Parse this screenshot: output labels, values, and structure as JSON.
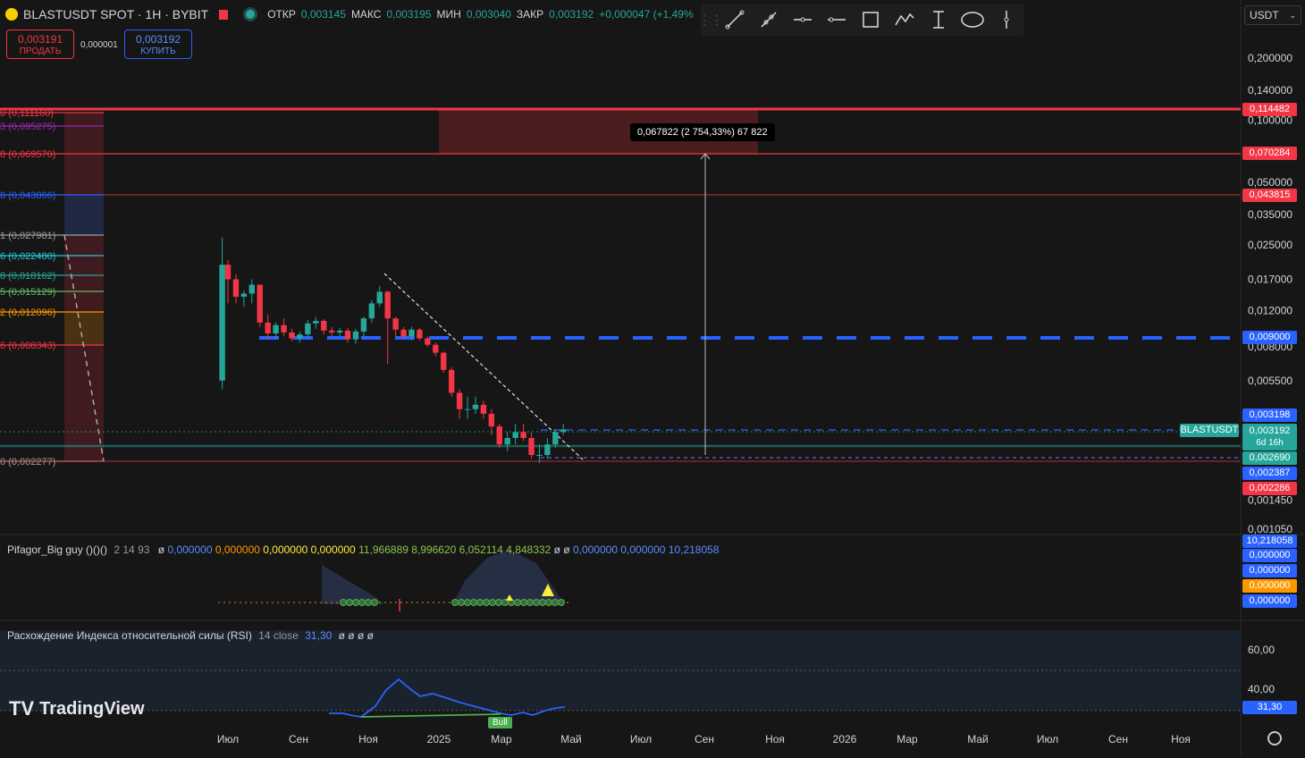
{
  "header": {
    "symbol": "BLASTUSDT SPOT · 1H · BYBIT",
    "open_label": "ОТКР",
    "open_value": "0,003145",
    "high_label": "МАКС",
    "high_value": "0,003195",
    "low_label": "МИН",
    "low_value": "0,003040",
    "close_label": "ЗАКР",
    "close_value": "0,003192",
    "change": "+0,000047 (+1,49%"
  },
  "trade": {
    "sell_price": "0,003191",
    "sell_label": "ПРОДАТЬ",
    "spread": "0,000001",
    "buy_price": "0,003192",
    "buy_label": "КУПИТЬ"
  },
  "currency": {
    "value": "USDT"
  },
  "toolbar": {
    "icons": [
      "drag-handle-icon",
      "trend-line-icon",
      "ray-icon",
      "horizontal-ray-icon",
      "horizontal-line-icon",
      "rectangle-icon",
      "path-icon",
      "long-position-icon",
      "ellipse-icon",
      "vertical-line-icon"
    ]
  },
  "price_axis": {
    "ticks": [
      "0,200000",
      "0,140000",
      "0,100000",
      "0,050000",
      "0,035000",
      "0,025000",
      "0,017000",
      "0,012000",
      "0,008000",
      "0,005500",
      "0,001450",
      "0,001050"
    ],
    "tags": {
      "t1": "0,114482",
      "t2": "0,070284",
      "t3": "0,043815",
      "t4": "0,009000",
      "t5": "0,003198",
      "t6": "0,003192",
      "t6b": "6d 16h",
      "t7": "0,002690",
      "t8": "0,002387",
      "t9": "0,002286"
    },
    "symbol_tag": "BLASTUSDT"
  },
  "measure": {
    "label": "0,067822 (2 754,33%) 67 822"
  },
  "fib_levels": [
    {
      "label": "0 (0,111160)",
      "color": "#f23645"
    },
    {
      "label": "3 (0,095275)",
      "color": "#9c27b0"
    },
    {
      "label": "8 (0,069570)",
      "color": "#f23645"
    },
    {
      "label": "8 (0,043866)",
      "color": "#2962ff"
    },
    {
      "label": "1 (0,027981)",
      "color": "#9e9e9e"
    },
    {
      "label": "6 (0,022480)",
      "color": "#26c6da"
    },
    {
      "label": "8 (0,018162)",
      "color": "#26a69a"
    },
    {
      "label": "5 (0,015129)",
      "color": "#66bb6a"
    },
    {
      "label": "2 (0,012096)",
      "color": "#ff9800"
    },
    {
      "label": "6 (0,008343)",
      "color": "#f23645"
    },
    {
      "label": "0 (0,002277)",
      "color": "#9e9e9e"
    }
  ],
  "time_axis": {
    "labels": [
      "Июл",
      "Сен",
      "Ноя",
      "2025",
      "Мар",
      "Май",
      "Июл",
      "Сен",
      "Ноя",
      "2026",
      "Мар",
      "Май",
      "Июл",
      "Сен",
      "Ноя"
    ]
  },
  "indicator1": {
    "name": "Pifagor_Big guy ()()()",
    "params": "2 14 93",
    "values": [
      "ø",
      "0,000000",
      "0,000000",
      "0,000000",
      "0,000000",
      "11,966889",
      "8,996620",
      "6,052114",
      "4,848332",
      "ø",
      "ø",
      "0,000000",
      "0,000000",
      "10,218058"
    ],
    "tags": [
      "10,218058",
      "0,000000",
      "0,000000",
      "0,000000",
      "0,000000"
    ]
  },
  "indicator2": {
    "name": "Расхождение Индекса относительной силы (RSI)",
    "params": "14 close",
    "value": "31,30",
    "extra": "ø ø ø ø",
    "ticks": [
      "60,00",
      "40,00"
    ],
    "tag": "31,30",
    "bull_label": "Bull"
  },
  "watermark": {
    "text": "TradingView"
  },
  "colors": {
    "up": "#26a69a",
    "down": "#f23645",
    "blue": "#2962ff",
    "bg": "#161616"
  },
  "chart_data": {
    "type": "candlestick",
    "title": "BLASTUSDT SPOT · 1H · BYBIT",
    "scale": "log",
    "ylim": [
      0.00105,
      0.2
    ],
    "candles_shown": "approximate weekly-scale view Jun 2024 – Apr 2025",
    "x": [
      "2024-06-26",
      "2024-07-01",
      "2024-07-08",
      "2024-07-15",
      "2024-07-22",
      "2024-07-29",
      "2024-08-05",
      "2024-08-12",
      "2024-08-19",
      "2024-08-26",
      "2024-09-02",
      "2024-09-09",
      "2024-09-16",
      "2024-09-23",
      "2024-09-30",
      "2024-10-07",
      "2024-10-14",
      "2024-10-21",
      "2024-10-28",
      "2024-11-04",
      "2024-11-11",
      "2024-11-18",
      "2024-11-25",
      "2024-12-02",
      "2024-12-09",
      "2024-12-16",
      "2024-12-23",
      "2024-12-30",
      "2025-01-06",
      "2025-01-13",
      "2025-01-20",
      "2025-01-27",
      "2025-02-03",
      "2025-02-10",
      "2025-02-17",
      "2025-02-24",
      "2025-03-03",
      "2025-03-10",
      "2025-03-17",
      "2025-03-24",
      "2025-03-31",
      "2025-04-07",
      "2025-04-14",
      "2025-04-21"
    ],
    "open": [
      0.0055,
      0.02,
      0.017,
      0.014,
      0.0145,
      0.016,
      0.0105,
      0.0093,
      0.0102,
      0.0094,
      0.0088,
      0.0092,
      0.0104,
      0.0107,
      0.0096,
      0.0094,
      0.0096,
      0.0087,
      0.0095,
      0.011,
      0.013,
      0.0148,
      0.011,
      0.0097,
      0.009,
      0.0097,
      0.0088,
      0.0082,
      0.0075,
      0.0062,
      0.0048,
      0.004,
      0.004,
      0.0042,
      0.0038,
      0.0033,
      0.0027,
      0.0029,
      0.0031,
      0.0029,
      0.0024,
      0.0024,
      0.0027,
      0.0031
    ],
    "close": [
      0.02,
      0.017,
      0.014,
      0.0145,
      0.016,
      0.0105,
      0.0093,
      0.0102,
      0.0094,
      0.0088,
      0.0092,
      0.0104,
      0.0107,
      0.0096,
      0.0094,
      0.0096,
      0.0087,
      0.0095,
      0.011,
      0.013,
      0.0148,
      0.011,
      0.0097,
      0.009,
      0.0097,
      0.0088,
      0.0082,
      0.0075,
      0.0062,
      0.0048,
      0.004,
      0.004,
      0.0042,
      0.0038,
      0.0033,
      0.0027,
      0.0029,
      0.0031,
      0.0029,
      0.0024,
      0.0024,
      0.0027,
      0.0031,
      0.003192
    ],
    "high": [
      0.027,
      0.021,
      0.018,
      0.015,
      0.017,
      0.016,
      0.0115,
      0.0105,
      0.011,
      0.0098,
      0.0095,
      0.0108,
      0.0112,
      0.0109,
      0.01,
      0.0099,
      0.0099,
      0.0098,
      0.0112,
      0.0135,
      0.0158,
      0.015,
      0.0112,
      0.01,
      0.01,
      0.0099,
      0.009,
      0.0084,
      0.0076,
      0.0064,
      0.005,
      0.0046,
      0.0046,
      0.0044,
      0.004,
      0.0034,
      0.0031,
      0.0034,
      0.0034,
      0.0031,
      0.0027,
      0.0029,
      0.0032,
      0.0034
    ],
    "low": [
      0.005,
      0.013,
      0.013,
      0.0125,
      0.013,
      0.01,
      0.0087,
      0.0088,
      0.009,
      0.0085,
      0.0084,
      0.0088,
      0.0098,
      0.0092,
      0.009,
      0.009,
      0.0084,
      0.0083,
      0.009,
      0.0105,
      0.0125,
      0.0066,
      0.009,
      0.0088,
      0.0086,
      0.0086,
      0.008,
      0.0072,
      0.006,
      0.0046,
      0.0036,
      0.0036,
      0.0038,
      0.0036,
      0.003,
      0.0026,
      0.0025,
      0.0027,
      0.0028,
      0.0023,
      0.0022,
      0.0023,
      0.0026,
      0.003
    ],
    "levels": [
      0.114482,
      0.070284,
      0.043815,
      0.009,
      0.003198,
      0.003192,
      0.00269,
      0.002387,
      0.002286
    ],
    "rsi": {
      "ylim": [
        20,
        70
      ],
      "last": 31.3
    }
  }
}
